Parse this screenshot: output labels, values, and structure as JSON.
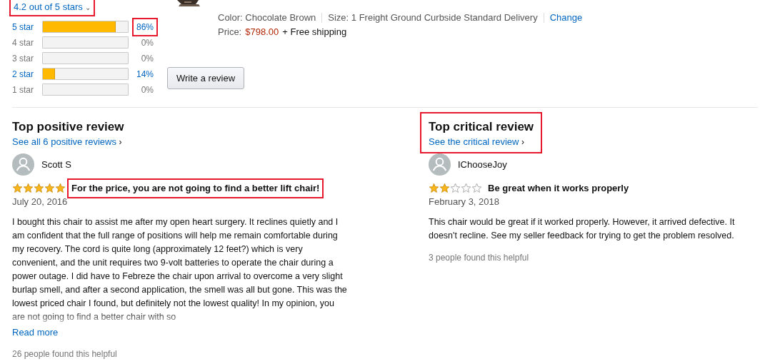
{
  "rating_summary": {
    "text": "4.2 out of 5 stars",
    "caret": "⌄",
    "highlighted": true
  },
  "histogram": [
    {
      "label": "5 star",
      "level": 0.86,
      "percent": "86%",
      "disabled": false,
      "highlighted": true
    },
    {
      "label": "4 star",
      "level": 0,
      "percent": "0%",
      "disabled": true,
      "highlighted": false
    },
    {
      "label": "3 star",
      "level": 0,
      "percent": "0%",
      "disabled": true,
      "highlighted": false
    },
    {
      "label": "2 star",
      "level": 0.14,
      "percent": "14%",
      "disabled": false,
      "highlighted": false
    },
    {
      "label": "1 star",
      "level": 0,
      "percent": "0%",
      "disabled": true,
      "highlighted": false
    }
  ],
  "product": {
    "color_option": "Color: Chocolate Brown",
    "size": "Size: 1 Freight Ground Curbside Standard Delivery",
    "change": "Change",
    "price_label": "Price:",
    "price": "$798.00",
    "shipping": "+ Free shipping"
  },
  "write_review_button": "Write a review",
  "reviews": [
    {
      "heading": "Top positive review",
      "link": "See all 6 positive reviews",
      "link_arrow": "›",
      "header_highlighted": false,
      "author": "Scott S",
      "stars": 5,
      "title": "For the price, you are not going to find a better lift chair!",
      "title_highlighted": true,
      "date": "July 20, 2016",
      "body": "I bought this chair to assist me after my open heart surgery. It reclines quietly and I am confident that the full range of positions will help me remain comfortable during my recovery. The cord is quite long (approximately 12 feet?) which is very convenient, and the unit requires two 9-volt batteries to operate the chair during a power outage. I did have to Febreze the chair upon arrival to overcome a very slight burlap smell, and after a second application, the smell was all but gone. This was the lowest priced chair I found, but definitely not the lowest quality! In my opinion, you are not going to find a better chair with so",
      "truncated": true,
      "read_more": "Read more",
      "helpful": "26 people found this helpful"
    },
    {
      "heading": "Top critical review",
      "link": "See the critical review",
      "link_arrow": "›",
      "header_highlighted": true,
      "author": "IChooseJoy",
      "stars": 2,
      "title": "Be great when it works properly",
      "title_highlighted": false,
      "date": "February 3, 2018",
      "body": "This chair would be great if it worked properly. However, it arrived defective. It doesn't recline. See my seller feedback for trying to get the problem resolved.",
      "truncated": false,
      "helpful": "3 people found this helpful"
    }
  ]
}
